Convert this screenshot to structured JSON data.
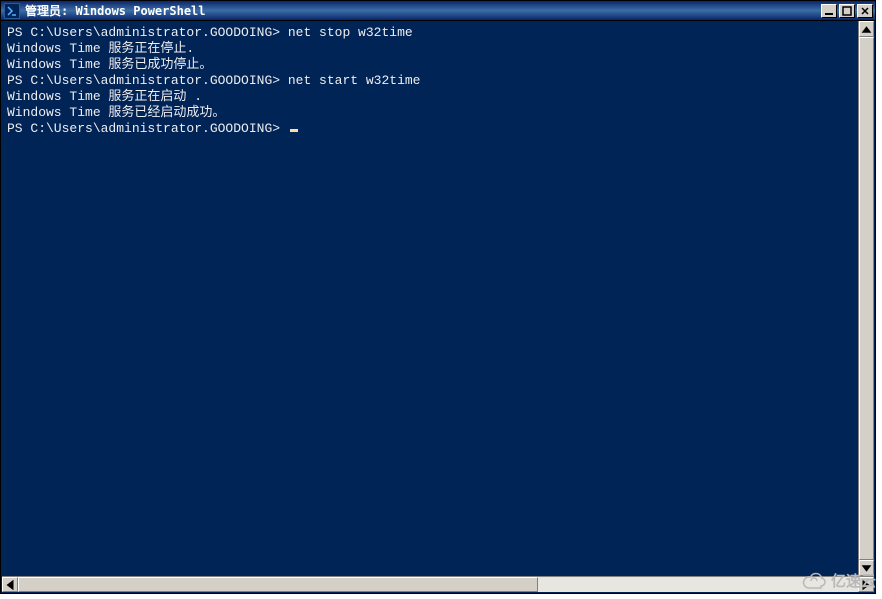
{
  "window": {
    "title": "管理员: Windows PowerShell"
  },
  "terminal": {
    "prompt": "PS C:\\Users\\administrator.GOODOING>",
    "lines": [
      {
        "prompt": "PS C:\\Users\\administrator.GOODOING>",
        "cmd": " net stop w32time"
      },
      {
        "text": "Windows Time 服务正在停止."
      },
      {
        "text": "Windows Time 服务已成功停止。"
      },
      {
        "text": ""
      },
      {
        "prompt": "PS C:\\Users\\administrator.GOODOING>",
        "cmd": " net start w32time"
      },
      {
        "text": "Windows Time 服务正在启动 ."
      },
      {
        "text": "Windows Time 服务已经启动成功。"
      },
      {
        "text": ""
      },
      {
        "prompt": "PS C:\\Users\\administrator.GOODOING>",
        "cmd": " ",
        "cursor": true
      }
    ]
  },
  "watermark": {
    "text": "亿速云"
  }
}
